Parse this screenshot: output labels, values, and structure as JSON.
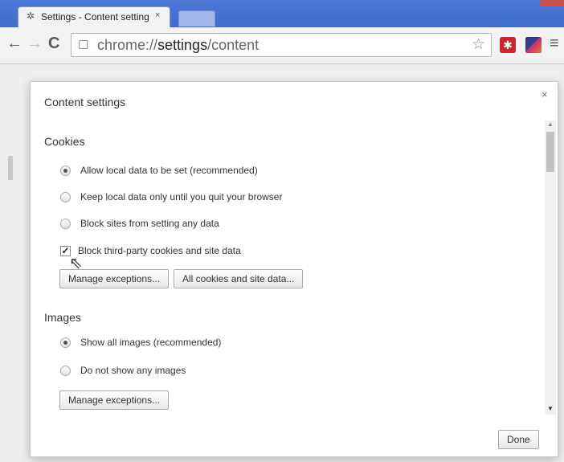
{
  "browser": {
    "tab_title": "Settings - Content setting",
    "tab_icon": "gear-icon",
    "url_scheme": "chrome://",
    "url_host": "settings",
    "url_path": "/content",
    "icons": {
      "back": "←",
      "forward": "→",
      "reload": "C",
      "page": "☐",
      "star": "☆",
      "menu": "≡",
      "tab_close": "×"
    }
  },
  "dialog": {
    "title": "Content settings",
    "close": "×",
    "done_label": "Done",
    "cookies": {
      "title": "Cookies",
      "options": [
        {
          "label": "Allow local data to be set (recommended)",
          "checked": true
        },
        {
          "label": "Keep local data only until you quit your browser",
          "checked": false
        },
        {
          "label": "Block sites from setting any data",
          "checked": false
        }
      ],
      "block_third_party": {
        "label": "Block third-party cookies and site data",
        "checked": true
      },
      "manage_exceptions_label": "Manage exceptions...",
      "all_cookies_label": "All cookies and site data..."
    },
    "images": {
      "title": "Images",
      "options": [
        {
          "label": "Show all images (recommended)",
          "checked": true
        },
        {
          "label": "Do not show any images",
          "checked": false
        }
      ],
      "manage_exceptions_label": "Manage exceptions..."
    }
  }
}
